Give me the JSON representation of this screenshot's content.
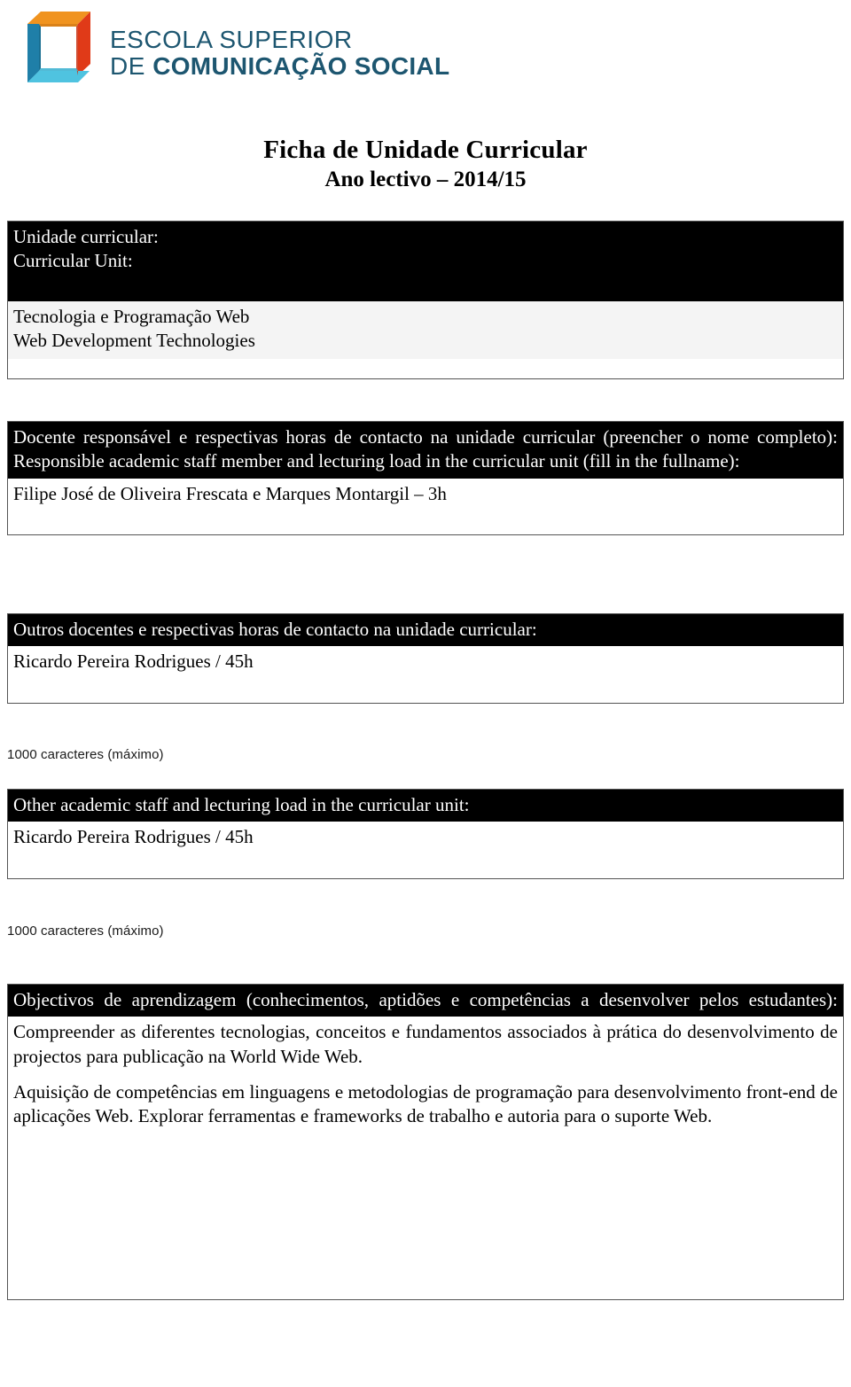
{
  "logo": {
    "icon": "escs-cube-logo",
    "line1": "ESCOLA SUPERIOR",
    "line2_light": "DE ",
    "line2_bold": "COMUNICAÇÃO SOCIAL",
    "colors": {
      "top": "#f0931f",
      "right": "#e03a18",
      "bottom": "#4fc3e0",
      "left": "#1f7fa8",
      "text": "#1d5670"
    }
  },
  "title": {
    "line1": "Ficha de Unidade Curricular",
    "line2": "Ano lectivo – 2014/15"
  },
  "sections": {
    "unit": {
      "header_pt": "Unidade curricular:",
      "header_en": "Curricular Unit:",
      "value_pt": "Tecnologia e Programação Web",
      "value_en": "Web Development Technologies"
    },
    "responsible": {
      "header_pt": "Docente responsável e respectivas horas de contacto na unidade curricular (preencher o nome completo):",
      "header_en": "Responsible academic staff member and lecturing load in the curricular unit (fill in the fullname):",
      "value": "Filipe José de Oliveira Frescata e Marques Montargil – 3h"
    },
    "other_pt": {
      "header": "Outros docentes e respectivas horas de contacto na unidade curricular:",
      "value": "Ricardo Pereira Rodrigues / 45h",
      "note": "1000 caracteres (máximo)"
    },
    "other_en": {
      "header": "Other academic staff and lecturing load in the curricular unit:",
      "value": "Ricardo Pereira Rodrigues / 45h",
      "note": "1000 caracteres (máximo)"
    },
    "objectives": {
      "header": "Objectivos de aprendizagem (conhecimentos, aptidões e competências a desenvolver pelos estudantes):",
      "paragraph_1": "Compreender as diferentes tecnologias, conceitos e fundamentos associados à prática do desenvolvimento de projectos para publicação na World Wide Web.",
      "paragraph_2": "Aquisição de competências em linguagens e metodologias de programação para desenvolvimento front-end de aplicações Web. Explorar ferramentas e frameworks de trabalho e autoria para o suporte Web."
    }
  }
}
